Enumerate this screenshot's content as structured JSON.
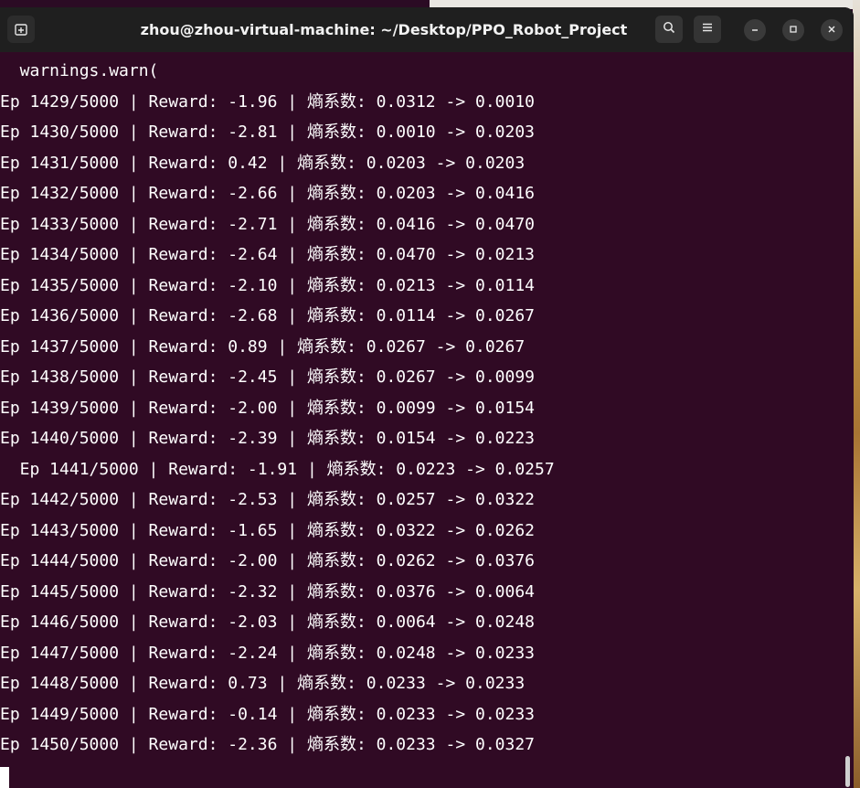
{
  "window": {
    "title": "zhou@zhou-virtual-machine: ~/Desktop/PPO_Robot_Project"
  },
  "icons": {
    "new_tab": "new-tab-icon",
    "search": "search-icon",
    "menu": "hamburger-menu-icon",
    "minimize": "minimize-icon",
    "maximize": "maximize-icon",
    "close": "close-icon"
  },
  "colors": {
    "terminal_bg": "#300a24",
    "titlebar_bg": "#1f1f1f",
    "text": "#ffffff"
  },
  "terminal": {
    "lines": [
      "  warnings.warn(",
      "Ep 1429/5000 | Reward: -1.96 | 熵系数: 0.0312 -> 0.0010",
      "Ep 1430/5000 | Reward: -2.81 | 熵系数: 0.0010 -> 0.0203",
      "Ep 1431/5000 | Reward: 0.42 | 熵系数: 0.0203 -> 0.0203",
      "Ep 1432/5000 | Reward: -2.66 | 熵系数: 0.0203 -> 0.0416",
      "Ep 1433/5000 | Reward: -2.71 | 熵系数: 0.0416 -> 0.0470",
      "Ep 1434/5000 | Reward: -2.64 | 熵系数: 0.0470 -> 0.0213",
      "Ep 1435/5000 | Reward: -2.10 | 熵系数: 0.0213 -> 0.0114",
      "Ep 1436/5000 | Reward: -2.68 | 熵系数: 0.0114 -> 0.0267",
      "Ep 1437/5000 | Reward: 0.89 | 熵系数: 0.0267 -> 0.0267",
      "Ep 1438/5000 | Reward: -2.45 | 熵系数: 0.0267 -> 0.0099",
      "Ep 1439/5000 | Reward: -2.00 | 熵系数: 0.0099 -> 0.0154",
      "Ep 1440/5000 | Reward: -2.39 | 熵系数: 0.0154 -> 0.0223",
      "  Ep 1441/5000 | Reward: -1.91 | 熵系数: 0.0223 -> 0.0257",
      "Ep 1442/5000 | Reward: -2.53 | 熵系数: 0.0257 -> 0.0322",
      "Ep 1443/5000 | Reward: -1.65 | 熵系数: 0.0322 -> 0.0262",
      "Ep 1444/5000 | Reward: -2.00 | 熵系数: 0.0262 -> 0.0376",
      "Ep 1445/5000 | Reward: -2.32 | 熵系数: 0.0376 -> 0.0064",
      "Ep 1446/5000 | Reward: -2.03 | 熵系数: 0.0064 -> 0.0248",
      "Ep 1447/5000 | Reward: -2.24 | 熵系数: 0.0248 -> 0.0233",
      "Ep 1448/5000 | Reward: 0.73 | 熵系数: 0.0233 -> 0.0233",
      "Ep 1449/5000 | Reward: -0.14 | 熵系数: 0.0233 -> 0.0233",
      "Ep 1450/5000 | Reward: -2.36 | 熵系数: 0.0233 -> 0.0327"
    ]
  }
}
